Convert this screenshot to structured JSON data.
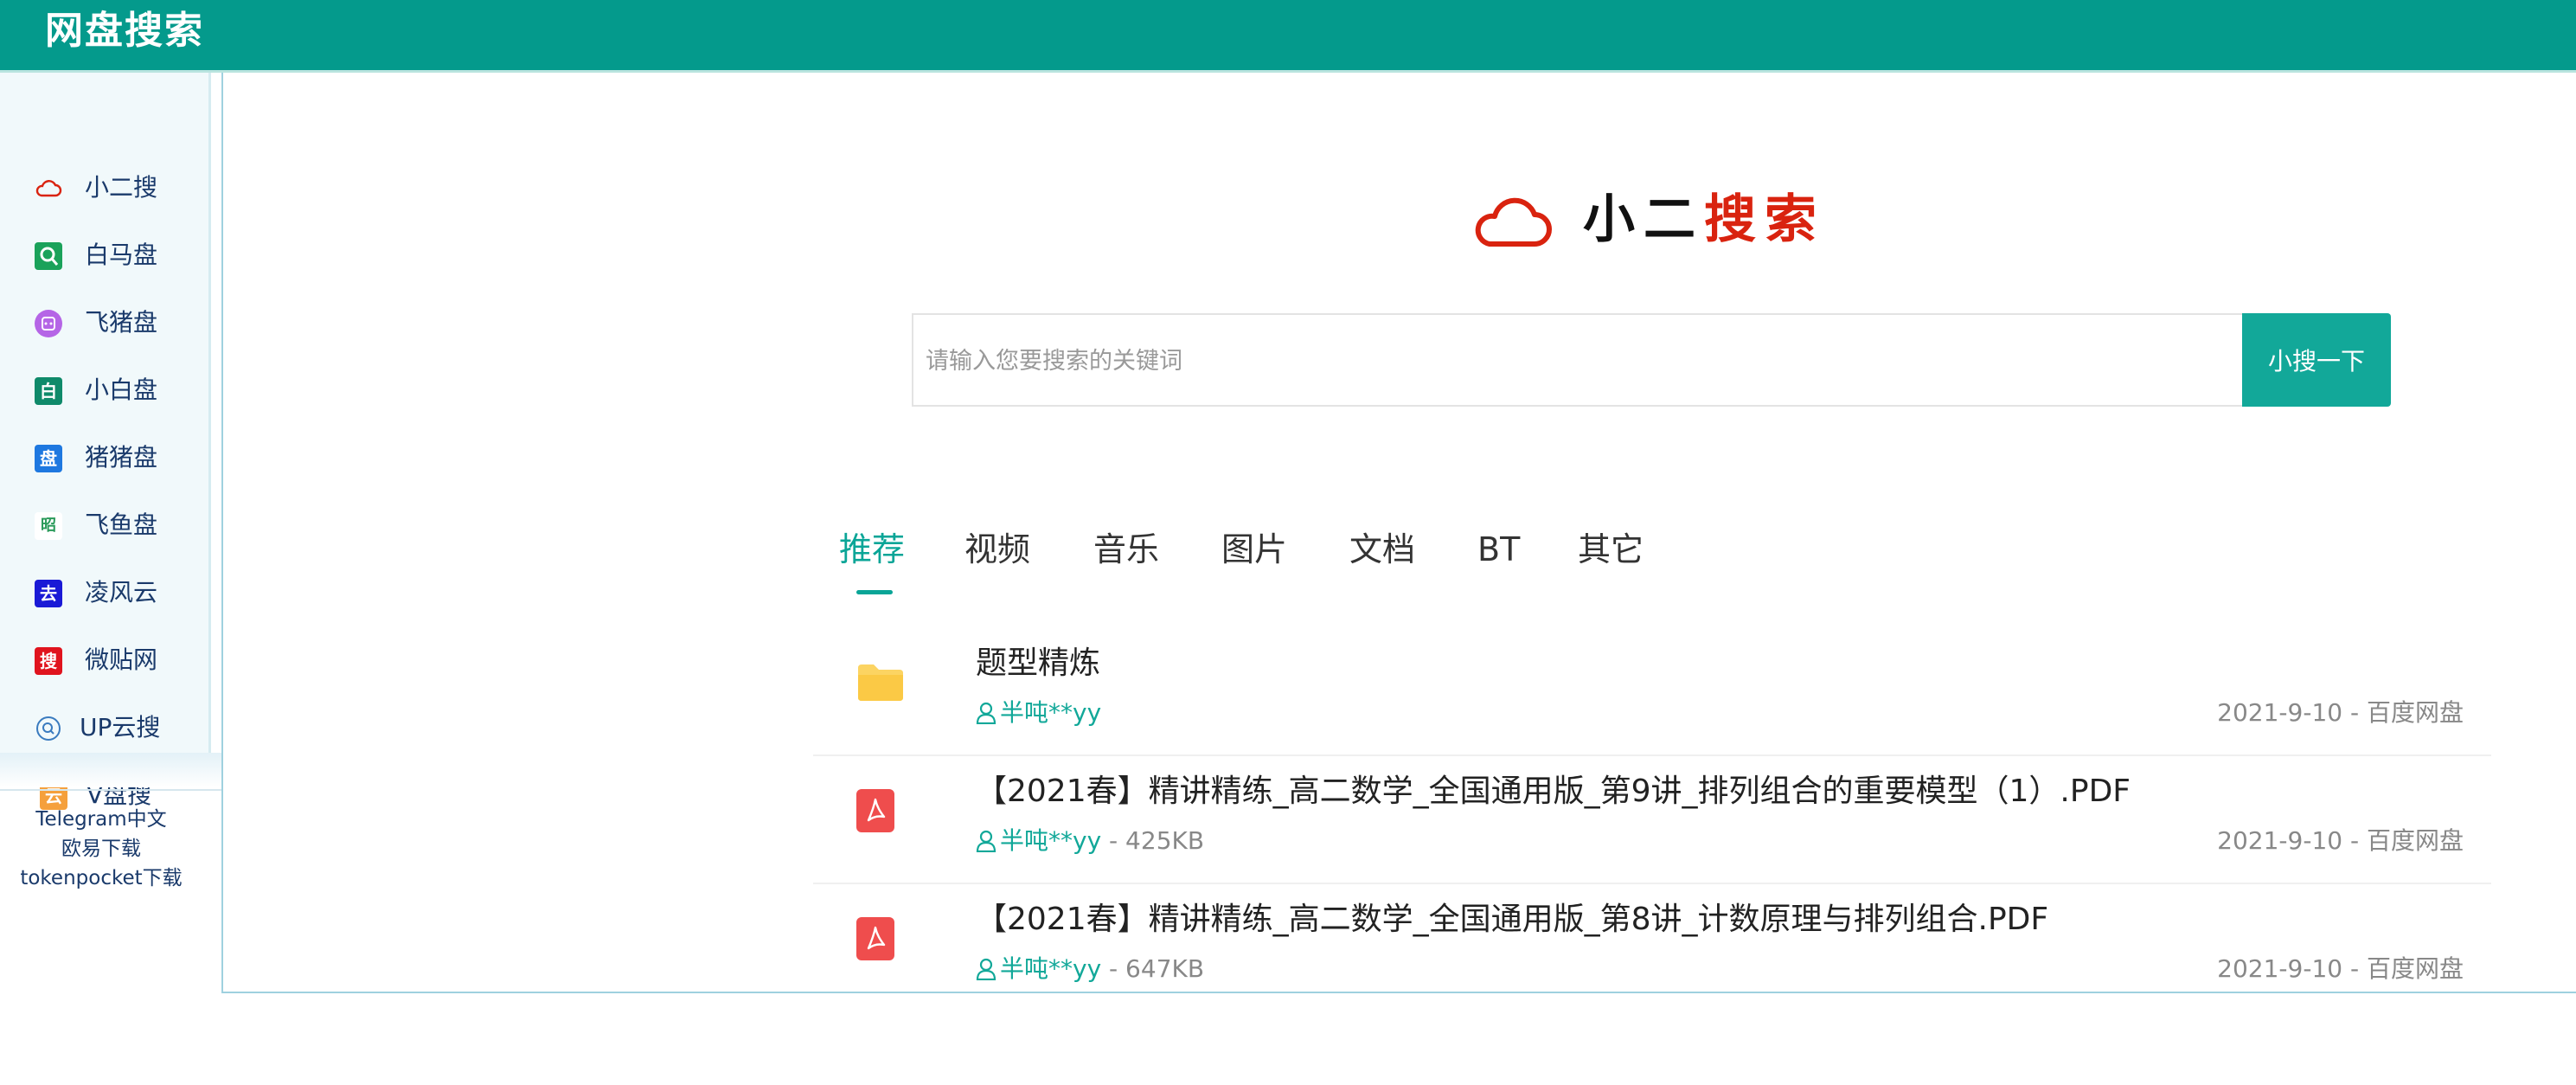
{
  "header": {
    "title": "网盘搜索"
  },
  "sidebar": {
    "items": [
      {
        "label": "小二搜",
        "icon": "cloud-outline-icon",
        "color": "#d9230f"
      },
      {
        "label": "白马盘",
        "icon": "magnifier-square-icon",
        "color": "#1aa25a"
      },
      {
        "label": "飞猪盘",
        "icon": "pig-circle-icon",
        "color": "#b565e6"
      },
      {
        "label": "小白盘",
        "icon": "bai-square-icon",
        "color": "#0f8a6a",
        "glyph": "白"
      },
      {
        "label": "猪猪盘",
        "icon": "pan-square-icon",
        "color": "#1e78e0",
        "glyph": "盘"
      },
      {
        "label": "飞鱼盘",
        "icon": "zhao-square-icon",
        "color": "#2a9a5a",
        "glyph": "昭"
      },
      {
        "label": "凌风云",
        "icon": "yun-square-icon",
        "color": "#1a1ad6",
        "glyph": "去"
      },
      {
        "label": "微贴网",
        "icon": "sou-square-icon",
        "color": "#e0141e",
        "glyph": "搜"
      },
      {
        "label": "UP云搜",
        "icon": "search-circle-icon",
        "color": "#3a7bbf"
      },
      {
        "label": "V盘搜",
        "icon": "yun-orange-square-icon",
        "color": "#f5a03c",
        "glyph": "云"
      }
    ],
    "links": [
      "Telegram中文",
      "欧易下载",
      "tokenpocket下载"
    ]
  },
  "logo": {
    "part1": "小二",
    "part2": "搜索"
  },
  "search": {
    "placeholder": "请输入您要搜索的关键词",
    "button": "小搜一下"
  },
  "tabs": [
    "推荐",
    "视频",
    "音乐",
    "图片",
    "文档",
    "BT",
    "其它"
  ],
  "active_tab": "推荐",
  "results": [
    {
      "icon": "folder-icon",
      "title": "题型精炼",
      "user": "半吨**yy",
      "size": "",
      "date_source": "2021-9-10 - 百度网盘"
    },
    {
      "icon": "pdf-icon",
      "title": "【2021春】精讲精练_高二数学_全国通用版_第9讲_排列组合的重要模型（1）.PDF",
      "user": "半吨**yy",
      "size": " - 425KB",
      "date_source": "2021-9-10 - 百度网盘"
    },
    {
      "icon": "pdf-icon",
      "title": "【2021春】精讲精练_高二数学_全国通用版_第8讲_计数原理与排列组合.PDF",
      "user": "半吨**yy",
      "size": " - 647KB",
      "date_source": "2021-9-10 - 百度网盘"
    }
  ],
  "colors": {
    "accent": "#049a8c",
    "brand_red": "#d9230f",
    "link_blue": "#1a3a6b"
  }
}
